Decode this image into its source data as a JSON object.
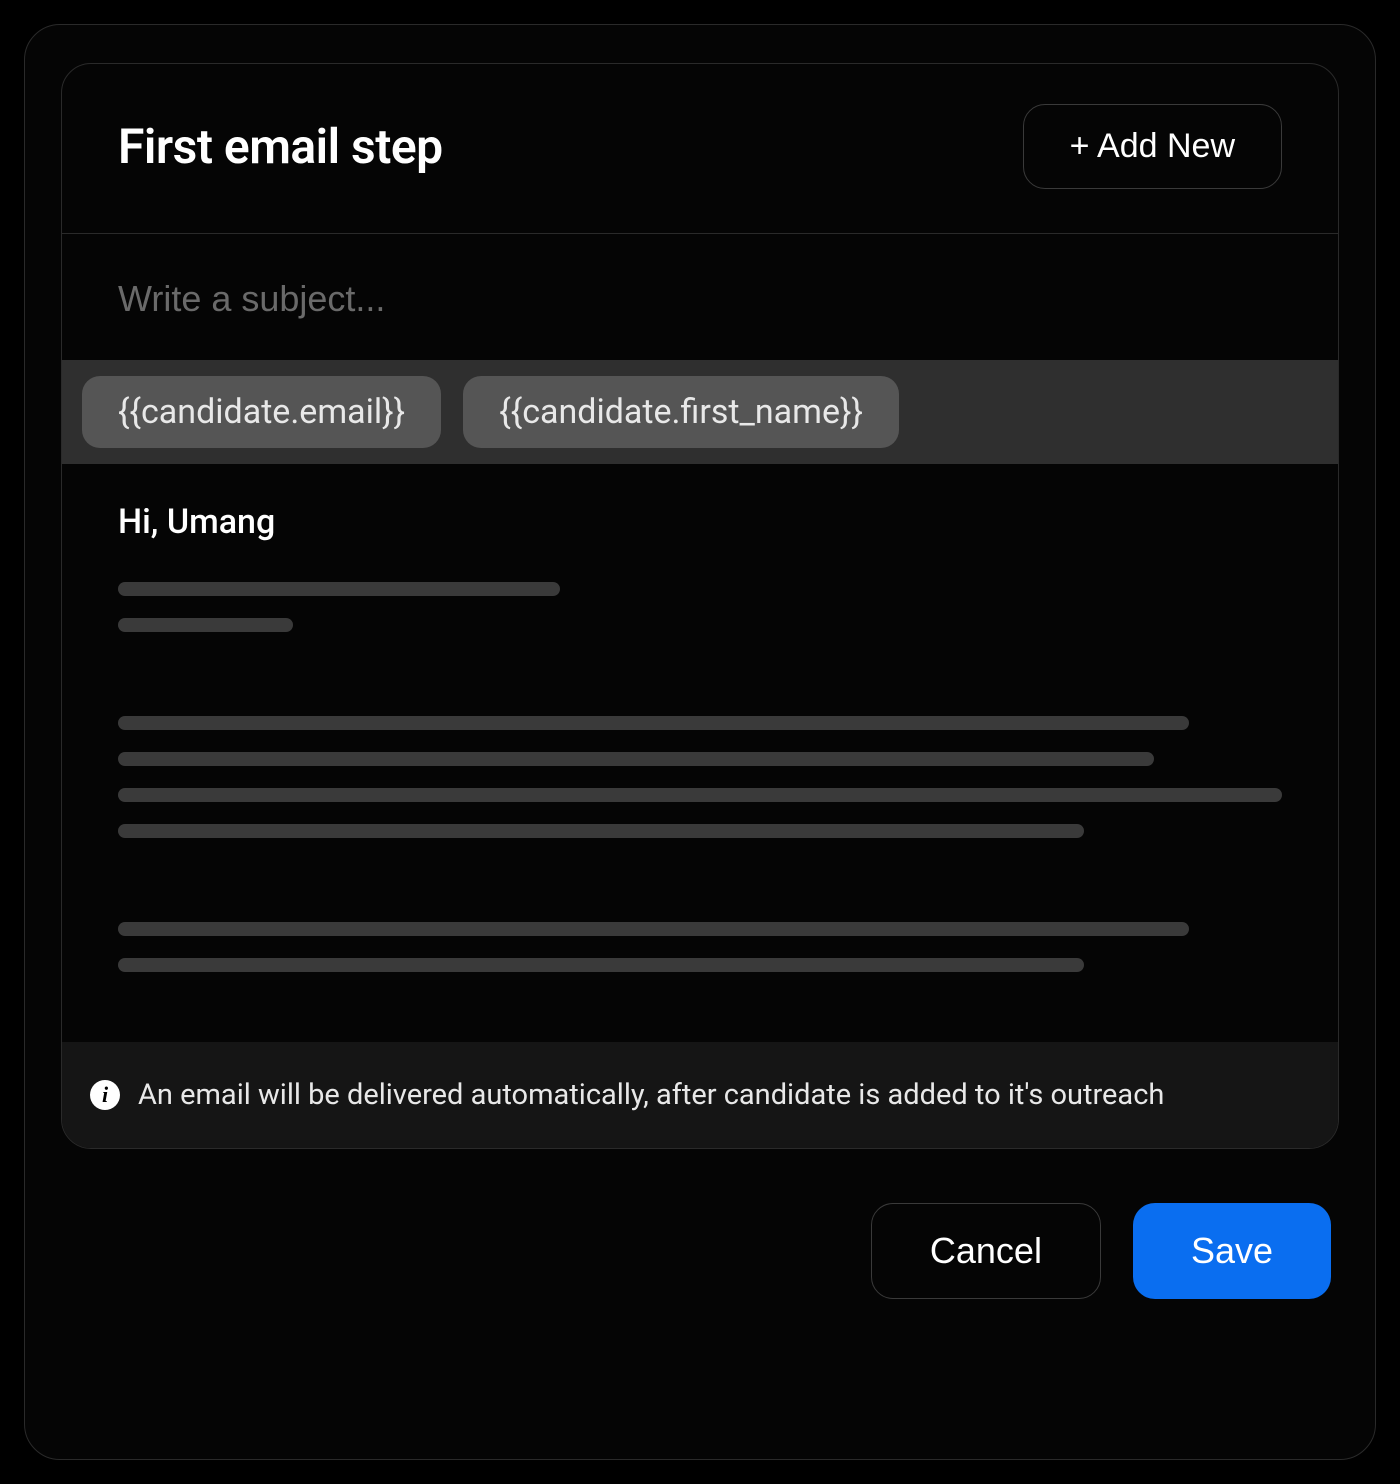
{
  "header": {
    "title": "First email step",
    "add_new_label": "+ Add New"
  },
  "subject": {
    "placeholder": "Write a subject...",
    "value": ""
  },
  "chips": [
    "{{candidate.email}}",
    "{{candidate.first_name}}"
  ],
  "body": {
    "greeting": "Hi, Umang"
  },
  "footer": {
    "info_text": "An email will be delivered automatically, after candidate is added to it's outreach"
  },
  "actions": {
    "cancel_label": "Cancel",
    "save_label": "Save"
  }
}
